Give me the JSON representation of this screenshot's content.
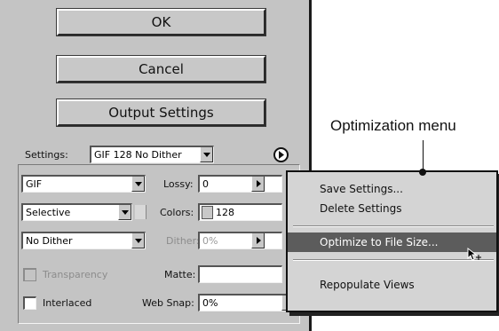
{
  "buttons": {
    "ok": "OK",
    "cancel": "Cancel",
    "output_settings": "Output Settings"
  },
  "settings": {
    "label": "Settings:",
    "value": "GIF 128 No Dither"
  },
  "format": {
    "value": "GIF"
  },
  "lossy": {
    "label": "Lossy:",
    "value": "0"
  },
  "palette": {
    "value": "Selective"
  },
  "colors": {
    "label": "Colors:",
    "value": "128"
  },
  "dither_algo": {
    "value": "No Dither"
  },
  "dither": {
    "label": "Dither:",
    "value": "0%"
  },
  "transparency": {
    "label": "Transparency",
    "checked": false,
    "enabled": false
  },
  "matte": {
    "label": "Matte:",
    "value": ""
  },
  "interlaced": {
    "label": "Interlaced",
    "checked": false
  },
  "web_snap": {
    "label": "Web Snap:",
    "value": "0%"
  },
  "optimize_menu": {
    "items": [
      "Save Settings...",
      "Delete Settings",
      "Optimize to File Size...",
      "Repopulate Views"
    ],
    "highlighted_index": 2
  },
  "callout": {
    "text": "Optimization menu"
  },
  "colors_theme": {
    "panel": "#c4c4c4",
    "menu": "#d4d4d4",
    "highlight": "#5c5c5c"
  },
  "icons": {
    "menu_button": "circle-triangle-right-icon",
    "cursor": "pointer-cursor-icon"
  }
}
